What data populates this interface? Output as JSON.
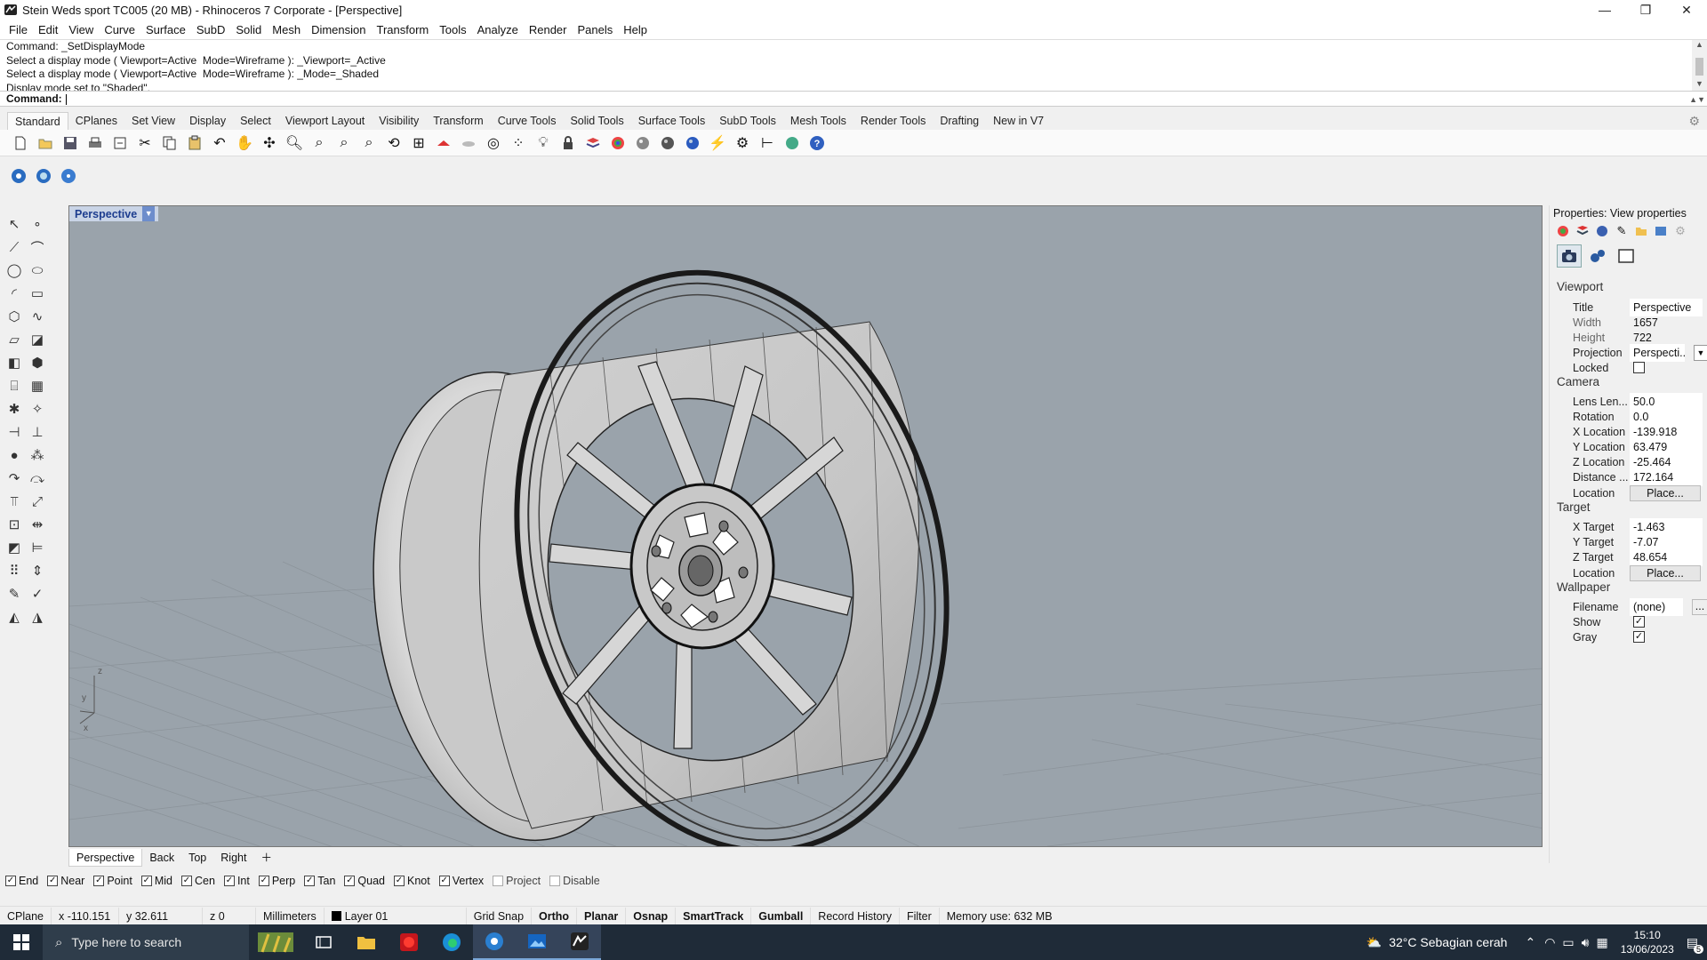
{
  "window": {
    "title": "Stein Weds sport TC005 (20 MB) - Rhinoceros 7 Corporate - [Perspective]",
    "minimize": "—",
    "maximize": "❐",
    "close": "✕"
  },
  "menu": [
    "File",
    "Edit",
    "View",
    "Curve",
    "Surface",
    "SubD",
    "Solid",
    "Mesh",
    "Dimension",
    "Transform",
    "Tools",
    "Analyze",
    "Render",
    "Panels",
    "Help"
  ],
  "command_history": [
    "Command: _SetDisplayMode",
    "Select a display mode ( Viewport=Active  Mode=Wireframe ): _Viewport=_Active",
    "Select a display mode ( Viewport=Active  Mode=Wireframe ): _Mode=_Shaded",
    "Display mode set to \"Shaded\"."
  ],
  "command_prompt": "Command:",
  "toolbar_tabs": [
    "Standard",
    "CPlanes",
    "Set View",
    "Display",
    "Select",
    "Viewport Layout",
    "Visibility",
    "Transform",
    "Curve Tools",
    "Solid Tools",
    "Surface Tools",
    "SubD Tools",
    "Mesh Tools",
    "Render Tools",
    "Drafting",
    "New in V7"
  ],
  "active_toolbar_tab": "Standard",
  "viewport": {
    "label": "Perspective",
    "axis_x": "x",
    "axis_y": "y",
    "axis_z": "z",
    "background": "#9aa3ab"
  },
  "viewport_tabs": [
    "Perspective",
    "Back",
    "Top",
    "Right"
  ],
  "osnaps": [
    {
      "label": "End",
      "checked": true
    },
    {
      "label": "Near",
      "checked": true
    },
    {
      "label": "Point",
      "checked": true
    },
    {
      "label": "Mid",
      "checked": true
    },
    {
      "label": "Cen",
      "checked": true
    },
    {
      "label": "Int",
      "checked": true
    },
    {
      "label": "Perp",
      "checked": true
    },
    {
      "label": "Tan",
      "checked": true
    },
    {
      "label": "Quad",
      "checked": true
    },
    {
      "label": "Knot",
      "checked": true
    },
    {
      "label": "Vertex",
      "checked": true
    },
    {
      "label": "Project",
      "checked": false
    },
    {
      "label": "Disable",
      "checked": false
    }
  ],
  "status": {
    "cplane": "CPlane",
    "x": "x -110.151",
    "y": "y 32.611",
    "z": "z 0",
    "units": "Millimeters",
    "layer": "Layer 01",
    "grid_snap": "Grid Snap",
    "ortho": "Ortho",
    "planar": "Planar",
    "osnap": "Osnap",
    "smarttrack": "SmartTrack",
    "gumball": "Gumball",
    "record_history": "Record History",
    "filter": "Filter",
    "memory": "Memory use: 632 MB"
  },
  "properties": {
    "panel_title": "Properties: View properties",
    "viewport_section": "Viewport",
    "title_label": "Title",
    "title_value": "Perspective",
    "width_label": "Width",
    "width_value": "1657",
    "height_label": "Height",
    "height_value": "722",
    "projection_label": "Projection",
    "projection_value": "Perspecti...",
    "locked_label": "Locked",
    "locked_checked": false,
    "camera_section": "Camera",
    "lens_label": "Lens Len...",
    "lens_value": "50.0",
    "rotation_label": "Rotation",
    "rotation_value": "0.0",
    "xloc_label": "X Location",
    "xloc_value": "-139.918",
    "yloc_label": "Y Location",
    "yloc_value": "63.479",
    "zloc_label": "Z Location",
    "zloc_value": "-25.464",
    "distance_label": "Distance ...",
    "distance_value": "172.164",
    "location_label": "Location",
    "place_button": "Place...",
    "target_section": "Target",
    "xt_label": "X Target",
    "xt_value": "-1.463",
    "yt_label": "Y Target",
    "yt_value": "-7.07",
    "zt_label": "Z Target",
    "zt_value": "48.654",
    "tlocation_label": "Location",
    "tplace_button": "Place...",
    "wallpaper_section": "Wallpaper",
    "filename_label": "Filename",
    "filename_value": "(none)",
    "filename_button": "...",
    "show_label": "Show",
    "show_checked": true,
    "gray_label": "Gray",
    "gray_checked": true
  },
  "taskbar": {
    "search_placeholder": "Type here to search",
    "weather": "32°C  Sebagian cerah",
    "time": "15:10",
    "date": "13/06/2023",
    "notifications": "5"
  }
}
